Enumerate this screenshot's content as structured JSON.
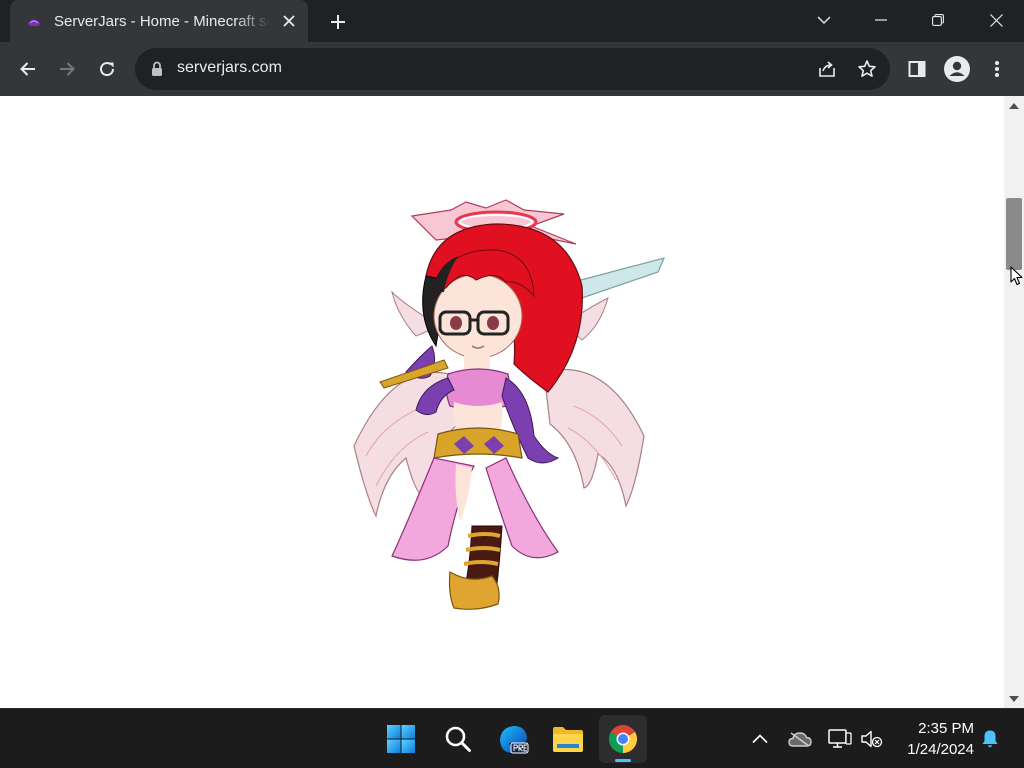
{
  "browser": {
    "tab": {
      "title": "ServerJars - Home - Minecraft server jars",
      "favicon": "serverjars-favicon"
    },
    "new_tab_icon": "plus-icon",
    "window_controls": [
      "chevron-down-icon",
      "minimize-icon",
      "restore-icon",
      "close-icon"
    ],
    "toolbar": {
      "url": "serverjars.com",
      "nav_icons": [
        "back-arrow-icon",
        "forward-arrow-icon",
        "reload-icon"
      ],
      "omnibox_icons": [
        "lock-icon",
        "share-icon",
        "star-icon"
      ],
      "right_icons": [
        "side-panel-icon",
        "profile-icon",
        "kebab-menu-icon"
      ]
    }
  },
  "page": {
    "hero_image": "chibi-angel-character-illustration"
  },
  "taskbar": {
    "apps": [
      "windows-start-icon",
      "search-icon",
      "edge-preview-icon",
      "file-explorer-icon",
      "chrome-icon"
    ],
    "active_app": "chrome-icon",
    "tray_icons": [
      "chevron-up-icon",
      "onedrive-icon",
      "display-icon",
      "volume-muted-icon",
      "notification-bell-icon"
    ],
    "clock": {
      "time": "2:35 PM",
      "date": "1/24/2024"
    }
  },
  "colors": {
    "titlebar": "#202124",
    "toolbar": "#35363a",
    "taskbar": "#1c1c1c",
    "accent": "#4cc2ff"
  }
}
